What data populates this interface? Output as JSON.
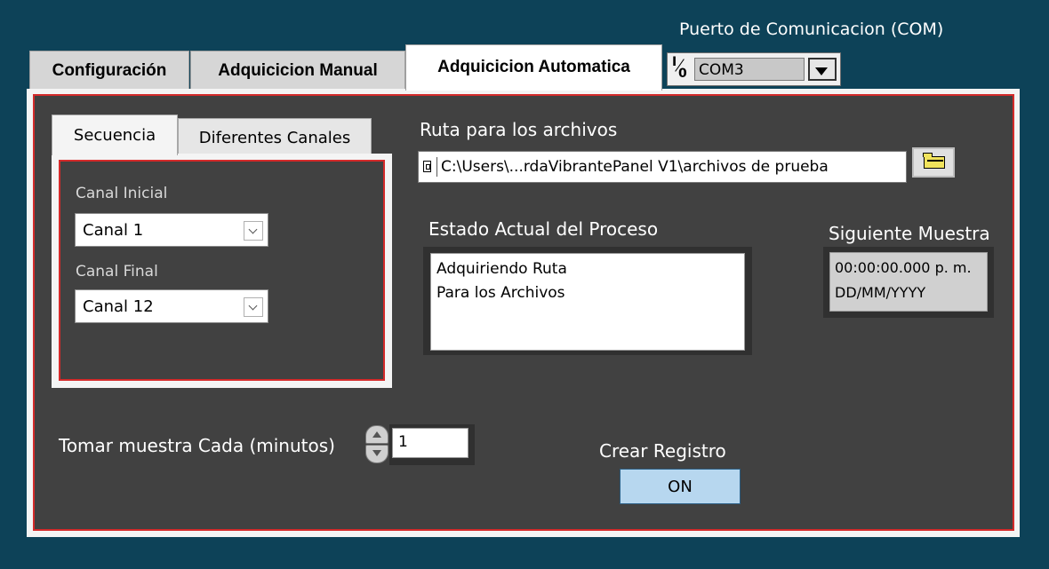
{
  "com": {
    "label": "Puerto de Comunicacion (COM)",
    "io_top": "I",
    "io_bottom": "0",
    "value": "COM3"
  },
  "tabs": [
    {
      "label": "Configuración"
    },
    {
      "label": "Adquicicion Manual"
    },
    {
      "label": "Adquicicion Automatica"
    }
  ],
  "subtabs": [
    {
      "label": "Secuencia"
    },
    {
      "label": "Diferentes Canales"
    }
  ],
  "canal_inicial": {
    "label": "Canal Inicial",
    "value": "Canal 1"
  },
  "canal_final": {
    "label": "Canal Final",
    "value": "Canal 12"
  },
  "ruta": {
    "label": "Ruta para los archivos",
    "value": "C:\\Users\\...rdaVibrantePanel V1\\archivos de prueba"
  },
  "estado": {
    "label": "Estado Actual del Proceso",
    "line1": "Adquiriendo Ruta",
    "line2": "Para los Archivos"
  },
  "siguiente": {
    "label": "Siguiente Muestra",
    "line1": "00:00:00.000 p. m.",
    "line2": "DD/MM/YYYY"
  },
  "muestra": {
    "label": "Tomar muestra Cada (minutos)",
    "value": "1"
  },
  "registro": {
    "label": "Crear Registro",
    "button": "ON"
  }
}
